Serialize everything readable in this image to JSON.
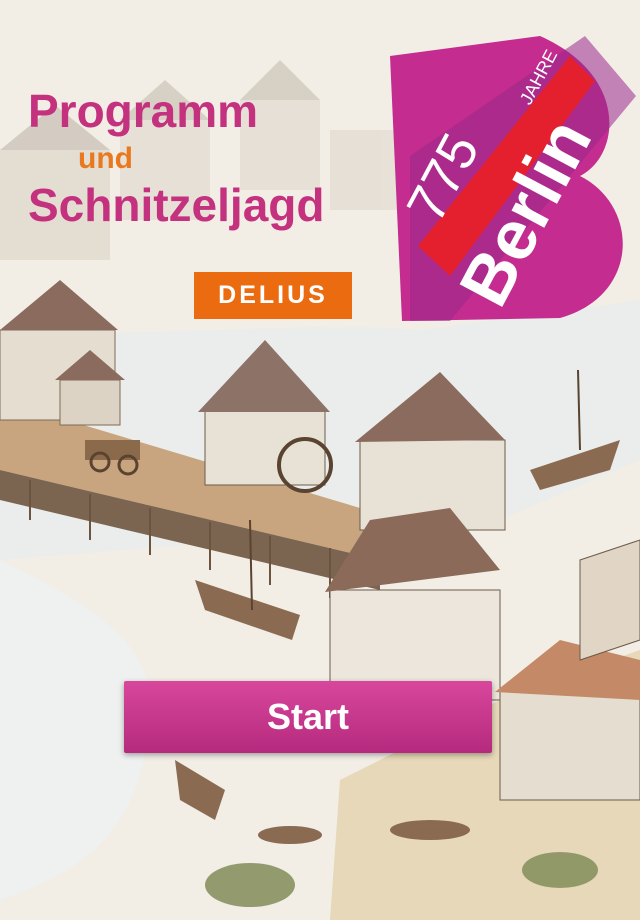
{
  "title": {
    "line1": "Programm",
    "line2": "und",
    "line3": "Schnitzeljagd"
  },
  "publisher": {
    "label": "DELIUS"
  },
  "logo": {
    "number": "775",
    "small_text": "JAHRE",
    "word": "Berlin"
  },
  "start_button": {
    "label": "Start"
  },
  "colors": {
    "title": "#c4317e",
    "und": "#e9791e",
    "publisher_bg": "#ea6b10",
    "logo_magenta": "#c42c8f",
    "logo_red": "#e4202e",
    "button": "#c53688"
  }
}
